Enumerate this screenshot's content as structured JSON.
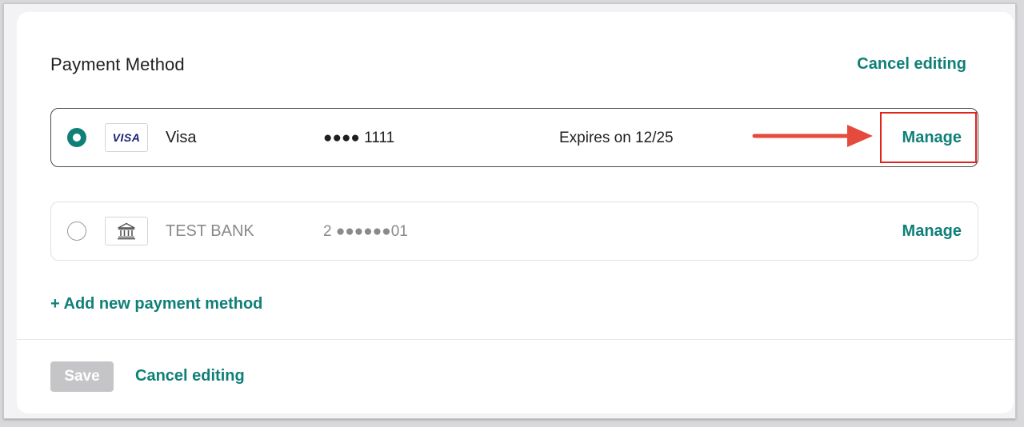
{
  "section": {
    "title": "Payment Method",
    "cancel_label": "Cancel editing"
  },
  "payment_methods": [
    {
      "logo": "VISA",
      "logo_icon": "visa-card-icon",
      "name": "Visa",
      "number": "●●●● 1111",
      "expiry": "Expires on 12/25",
      "selected": true,
      "manage_label": "Manage"
    },
    {
      "logo_icon": "bank-icon",
      "name": "TEST BANK",
      "number": "2 ●●●●●●01",
      "selected": false,
      "manage_label": "Manage"
    }
  ],
  "add_new_label": "+ Add new payment method",
  "footer": {
    "save_label": "Save",
    "cancel_label": "Cancel editing"
  },
  "colors": {
    "accent": "#0f7f78",
    "annotation": "#e0241b",
    "disabled": "#c5c5c8"
  }
}
